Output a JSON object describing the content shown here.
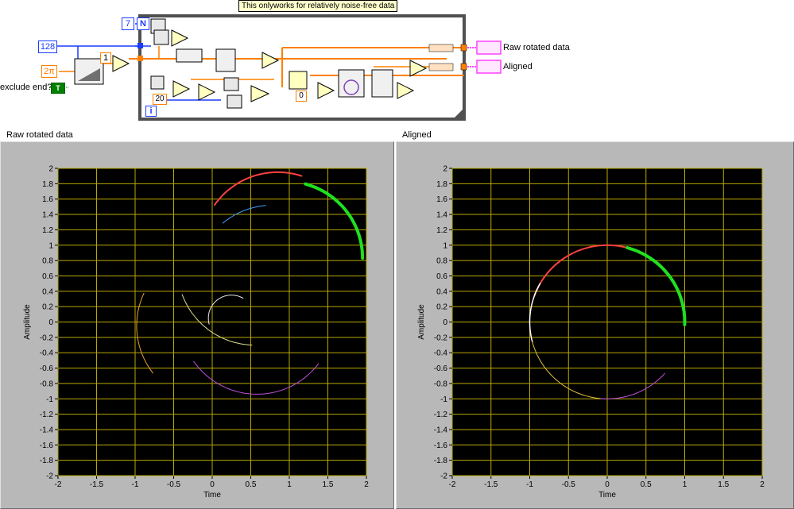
{
  "diagram": {
    "comment": "This onlyworks for relatively noise-free data",
    "const_128": "128",
    "const_2pi": "2π",
    "const_1": "1",
    "const_20": "20",
    "const_0": "0",
    "count_n_value": "7",
    "count_n_label": "N",
    "iteration_label": "i",
    "exclude_end_label": "exclude end?",
    "exclude_end_value": "T",
    "output_raw": "Raw rotated data",
    "output_aligned": "Aligned"
  },
  "charts": [
    {
      "label": "Raw rotated data",
      "xlabel": "Time",
      "ylabel": "Amplitude",
      "xlim": [
        -2,
        2
      ],
      "ylim": [
        -2,
        2
      ],
      "xticks": [
        "-2",
        "-1.5",
        "-1",
        "-0.5",
        "0",
        "0.5",
        "1",
        "1.5",
        "2"
      ],
      "yticks": [
        "2",
        "1.8",
        "1.6",
        "1.4",
        "1.2",
        "1",
        "0.8",
        "0.6",
        "0.4",
        "0.2",
        "0",
        "-0.2",
        "-0.4",
        "-0.6",
        "-0.8",
        "-1",
        "-1.2",
        "-1.4",
        "-1.6",
        "-1.8",
        "-2"
      ],
      "background": "#000000",
      "grid_color": "#b8a800",
      "grid": true
    },
    {
      "label": "Aligned",
      "xlabel": "Time",
      "ylabel": "Amplitude",
      "xlim": [
        -2,
        2
      ],
      "ylim": [
        -2,
        2
      ],
      "xticks": [
        "-2",
        "-1.5",
        "-1",
        "-0.5",
        "0",
        "0.5",
        "1",
        "1.5",
        "2"
      ],
      "yticks": [
        "2",
        "1.8",
        "1.6",
        "1.4",
        "1.2",
        "1",
        "0.8",
        "0.6",
        "0.4",
        "0.2",
        "0",
        "-0.2",
        "-0.4",
        "-0.6",
        "-0.8",
        "-1",
        "-1.2",
        "-1.4",
        "-1.6",
        "-1.8",
        "-2"
      ],
      "background": "#000000",
      "grid_color": "#b8a800",
      "grid": true
    }
  ],
  "chart_data": [
    {
      "type": "line",
      "xlabel": "Time",
      "ylabel": "Amplitude",
      "xlim": [
        -2,
        2
      ],
      "ylim": [
        -2,
        2
      ],
      "series": [
        {
          "color": "#ff4040",
          "width": 2,
          "cx": 0.85,
          "cy": 0.95,
          "r": 1.0,
          "a0": 72,
          "a1": 145
        },
        {
          "color": "#20e020",
          "width": 4,
          "cx": 0.95,
          "cy": 0.83,
          "r": 1.0,
          "a0": 0,
          "a1": 75
        },
        {
          "color": "#40a0ff",
          "width": 1,
          "cx": 0.78,
          "cy": 0.52,
          "r": 1.0,
          "a0": 95,
          "a1": 130
        },
        {
          "color": "#e8e8e8",
          "width": 1,
          "cx": 0.25,
          "cy": 0.05,
          "r": 0.3,
          "a0": 60,
          "a1": 195
        },
        {
          "color": "#e0e090",
          "width": 1,
          "cx": 0.55,
          "cy": 0.7,
          "r": 1.0,
          "a0": 200,
          "a1": 268
        },
        {
          "color": "#e8a030",
          "width": 1,
          "cx": 0.02,
          "cy": -0.05,
          "r": 1.0,
          "a0": 155,
          "a1": 218
        },
        {
          "color": "#c050e0",
          "width": 1,
          "cx": 0.58,
          "cy": 0.06,
          "r": 1.0,
          "a0": 215,
          "a1": 323
        }
      ]
    },
    {
      "type": "line",
      "xlabel": "Time",
      "ylabel": "Amplitude",
      "xlim": [
        -2,
        2
      ],
      "ylim": [
        -2,
        2
      ],
      "series": [
        {
          "color": "#ff4040",
          "width": 2,
          "cx": 0,
          "cy": 0,
          "r": 1.0,
          "a0": 45,
          "a1": 160
        },
        {
          "color": "#20e020",
          "width": 4,
          "cx": 0,
          "cy": 0,
          "r": 1.0,
          "a0": -2,
          "a1": 75
        },
        {
          "color": "#ffffff",
          "width": 1.5,
          "cx": 0,
          "cy": 0,
          "r": 1.0,
          "a0": 150,
          "a1": 195
        },
        {
          "color": "#e8c040",
          "width": 1,
          "cx": 0,
          "cy": 0,
          "r": 1.0,
          "a0": 195,
          "a1": 265
        },
        {
          "color": "#c050e0",
          "width": 1,
          "cx": 0,
          "cy": 0,
          "r": 1.0,
          "a0": 265,
          "a1": 318
        }
      ]
    }
  ]
}
